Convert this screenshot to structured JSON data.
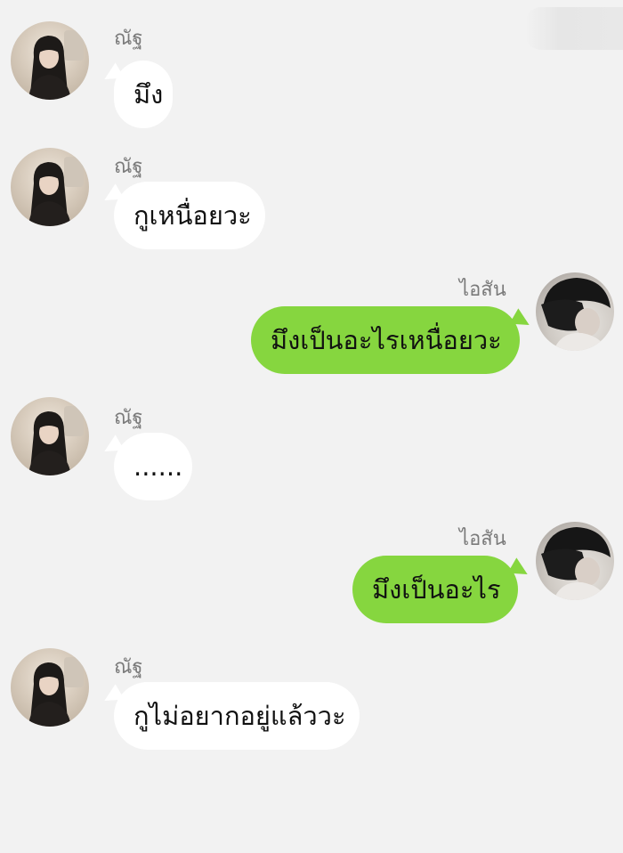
{
  "contacts": {
    "her": {
      "name": "ณัฐ"
    },
    "him": {
      "name": "ไอสัน"
    }
  },
  "messages": [
    {
      "sender": "her",
      "name": "ณัฐ",
      "text": "มึง"
    },
    {
      "sender": "her",
      "name": "ณัฐ",
      "text": "กูเหนื่อยวะ"
    },
    {
      "sender": "him",
      "name": "ไอสัน",
      "text": "มึงเป็นอะไรเหนื่อยวะ"
    },
    {
      "sender": "her",
      "name": "ณัฐ",
      "text": "......"
    },
    {
      "sender": "him",
      "name": "ไอสัน",
      "text": "มึงเป็นอะไร"
    },
    {
      "sender": "her",
      "name": "ณัฐ",
      "text": "กูไม่อยากอยู่แล้ววะ"
    }
  ],
  "colors": {
    "background": "#f2f2f2",
    "incoming_bubble": "#ffffff",
    "outgoing_bubble": "#86d63f",
    "name_text": "#7a7a7a"
  }
}
